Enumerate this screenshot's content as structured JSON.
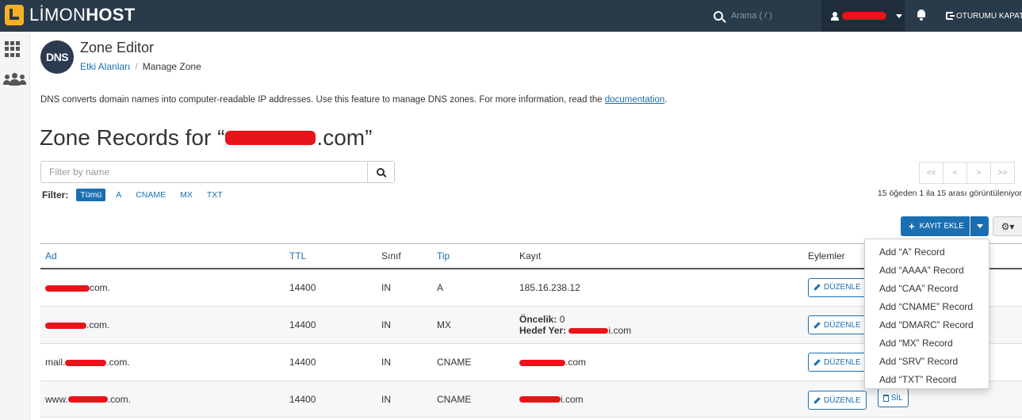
{
  "topbar": {
    "brand_light": "LİMON",
    "brand_bold": "HOST",
    "search_placeholder": "Arama ( / )",
    "logout_label": "OTURUMU KAPAT"
  },
  "header": {
    "title": "Zone Editor",
    "logo_text": "DNS",
    "breadcrumb_link": "Etki Alanları",
    "breadcrumb_current": "Manage Zone"
  },
  "description": {
    "text": "DNS converts domain names into computer-readable IP addresses. Use this feature to manage DNS zones. For more information, read the ",
    "link": "documentation",
    "end": "."
  },
  "zone_heading": {
    "prefix": "Zone Records for “",
    "suffix": ".com”"
  },
  "search": {
    "placeholder": "Filter by name"
  },
  "filter": {
    "label": "Filter:",
    "chips": [
      "Tümü",
      "A",
      "CNAME",
      "MX",
      "TXT"
    ]
  },
  "pagination": {
    "buttons": [
      "<<",
      "<",
      ">",
      ">>"
    ],
    "info": "15 öğeden 1 ila 15 arası görüntüleniyor"
  },
  "actions": {
    "add_label": "KAYIT EKLE"
  },
  "table": {
    "headers": [
      "Ad",
      "TTL",
      "Sınıf",
      "Tip",
      "Kayıt",
      "Eylemler"
    ],
    "rows": [
      {
        "name_suffix": "com.",
        "ttl": "14400",
        "class": "IN",
        "type": "A",
        "record": "185.16.238.12",
        "edit": "DÜZENLE"
      },
      {
        "name_suffix": ".com.",
        "ttl": "14400",
        "class": "IN",
        "type": "MX",
        "priority_label": "Öncelik:",
        "priority_value": "0",
        "target_label": "Hedef Yer:",
        "target_suffix": "i.com",
        "edit": "DÜZENLE"
      },
      {
        "name_prefix": "mail.",
        "name_suffix": ".com.",
        "ttl": "14400",
        "class": "IN",
        "type": "CNAME",
        "record_suffix": ".com",
        "edit": "DÜZENLE"
      },
      {
        "name_prefix": "www.",
        "name_suffix": ".com.",
        "ttl": "14400",
        "class": "IN",
        "type": "CNAME",
        "record_suffix": "i.com",
        "edit": "DÜZENLE",
        "delete": "SİL"
      }
    ]
  },
  "dropdown": {
    "items": [
      "Add “A” Record",
      "Add “AAAA” Record",
      "Add “CAA” Record",
      "Add “CNAME” Record",
      "Add “DMARC” Record",
      "Add “MX” Record",
      "Add “SRV” Record",
      "Add “TXT” Record"
    ]
  },
  "colors": {
    "topbar": "#293a4a",
    "accent": "#1a6fb2",
    "redaction": "#e8141a"
  }
}
